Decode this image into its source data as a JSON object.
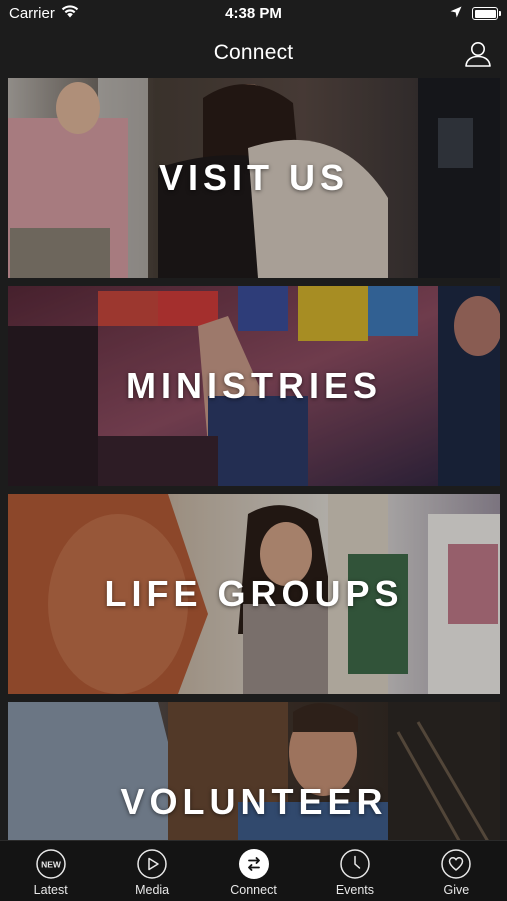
{
  "status_bar": {
    "carrier": "Carrier",
    "time": "4:38 PM"
  },
  "nav": {
    "title": "Connect",
    "profile_icon": "person-icon"
  },
  "cards": [
    {
      "label": "VISIT US"
    },
    {
      "label": "MINISTRIES"
    },
    {
      "label": "LIFE GROUPS"
    },
    {
      "label": "VOLUNTEER"
    }
  ],
  "tabs": [
    {
      "label": "Latest",
      "icon": "new-badge-icon",
      "icon_text": "NEW",
      "active": false
    },
    {
      "label": "Media",
      "icon": "play-icon",
      "active": false
    },
    {
      "label": "Connect",
      "icon": "swap-arrows-icon",
      "active": true
    },
    {
      "label": "Events",
      "icon": "clock-icon",
      "active": false
    },
    {
      "label": "Give",
      "icon": "heart-icon",
      "active": false
    }
  ]
}
